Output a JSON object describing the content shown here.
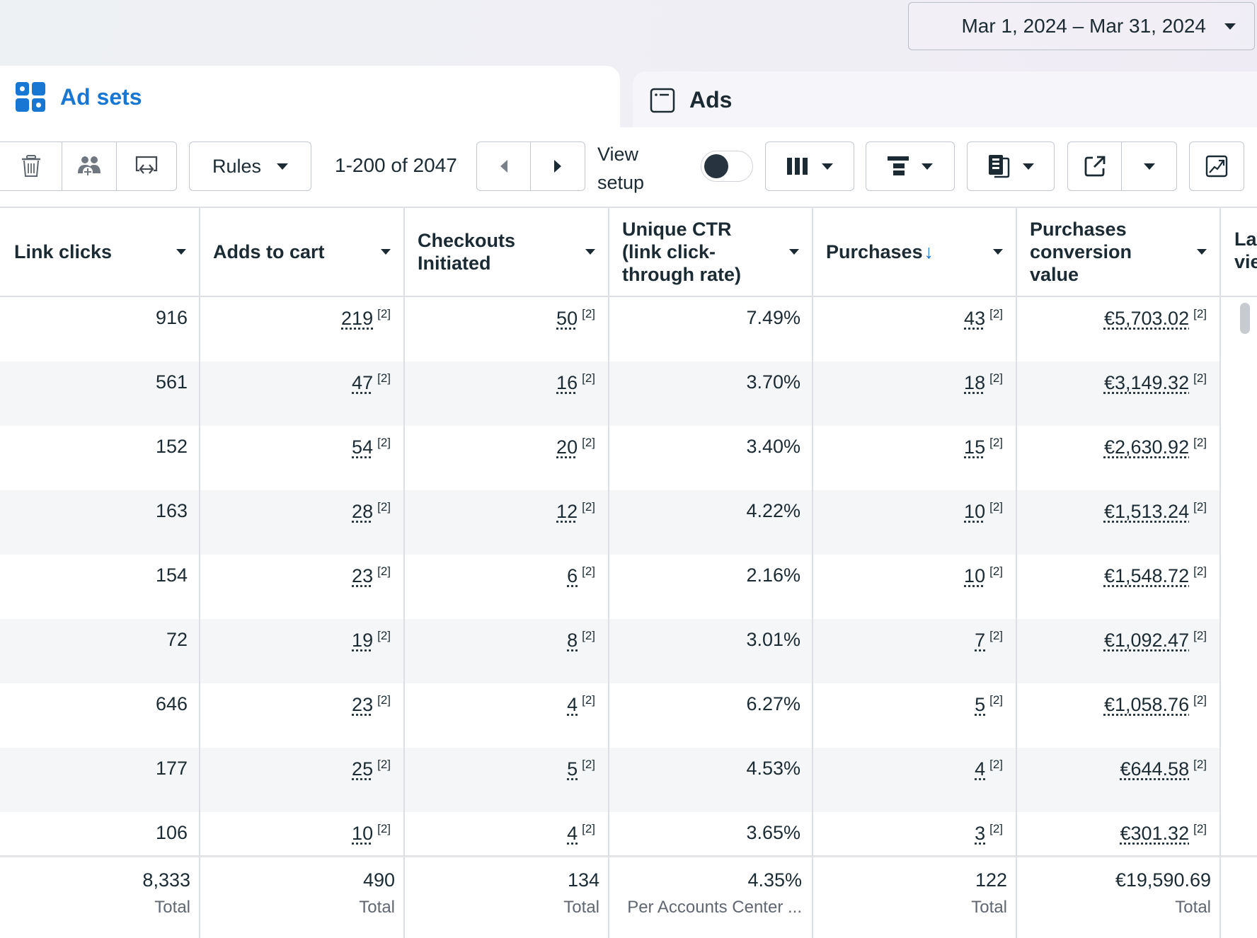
{
  "date_range": {
    "label": "Mar 1, 2024 – Mar 31, 2024",
    "icon": "caret-down-icon"
  },
  "tabs": [
    {
      "label": "Ad sets",
      "icon": "ad-sets-grid-icon",
      "active": true,
      "color": "#1877d2"
    },
    {
      "label": "Ads",
      "icon": "ad-window-icon",
      "active": false
    }
  ],
  "toolbar": {
    "icons": [
      "delete-icon",
      "audience-add-icon",
      "compare-icon"
    ],
    "rules_label": "Rules",
    "pagination": "1-200 of 2047",
    "view_setup_label": "View setup",
    "view_setup_toggle": false,
    "right_icons": [
      "columns-icon",
      "breakdown-icon",
      "reports-icon",
      "export-icon",
      "charts-icon"
    ]
  },
  "table": {
    "columns": [
      {
        "label": "Link clicks"
      },
      {
        "label": "Adds to cart"
      },
      {
        "label": "Checkouts Initiated"
      },
      {
        "label": "Unique CTR (link click-through rate)"
      },
      {
        "label": "Purchases",
        "sorted": "desc"
      },
      {
        "label": "Purchases conversion value"
      }
    ],
    "partial_column_label": "Landing page views",
    "footnote_marker": "[2]",
    "rows": [
      {
        "link_clicks": "916",
        "adds_to_cart": "219",
        "checkouts": "50",
        "unique_ctr": "7.49%",
        "purchases": "43",
        "conversion_value": "€5,703.02"
      },
      {
        "link_clicks": "561",
        "adds_to_cart": "47",
        "checkouts": "16",
        "unique_ctr": "3.70%",
        "purchases": "18",
        "conversion_value": "€3,149.32"
      },
      {
        "link_clicks": "152",
        "adds_to_cart": "54",
        "checkouts": "20",
        "unique_ctr": "3.40%",
        "purchases": "15",
        "conversion_value": "€2,630.92"
      },
      {
        "link_clicks": "163",
        "adds_to_cart": "28",
        "checkouts": "12",
        "unique_ctr": "4.22%",
        "purchases": "10",
        "conversion_value": "€1,513.24"
      },
      {
        "link_clicks": "154",
        "adds_to_cart": "23",
        "checkouts": "6",
        "unique_ctr": "2.16%",
        "purchases": "10",
        "conversion_value": "€1,548.72"
      },
      {
        "link_clicks": "72",
        "adds_to_cart": "19",
        "checkouts": "8",
        "unique_ctr": "3.01%",
        "purchases": "7",
        "conversion_value": "€1,092.47"
      },
      {
        "link_clicks": "646",
        "adds_to_cart": "23",
        "checkouts": "4",
        "unique_ctr": "6.27%",
        "purchases": "5",
        "conversion_value": "€1,058.76"
      },
      {
        "link_clicks": "177",
        "adds_to_cart": "25",
        "checkouts": "5",
        "unique_ctr": "4.53%",
        "purchases": "4",
        "conversion_value": "€644.58"
      },
      {
        "link_clicks": "106",
        "adds_to_cart": "10",
        "checkouts": "4",
        "unique_ctr": "3.65%",
        "purchases": "3",
        "conversion_value": "€301.32"
      }
    ],
    "totals": [
      {
        "value": "8,333",
        "label": "Total"
      },
      {
        "value": "490",
        "label": "Total"
      },
      {
        "value": "134",
        "label": "Total"
      },
      {
        "value": "4.35%",
        "label": "Per Accounts Center ..."
      },
      {
        "value": "122",
        "label": "Total"
      },
      {
        "value": "€19,590.69",
        "label": "Total"
      }
    ]
  }
}
